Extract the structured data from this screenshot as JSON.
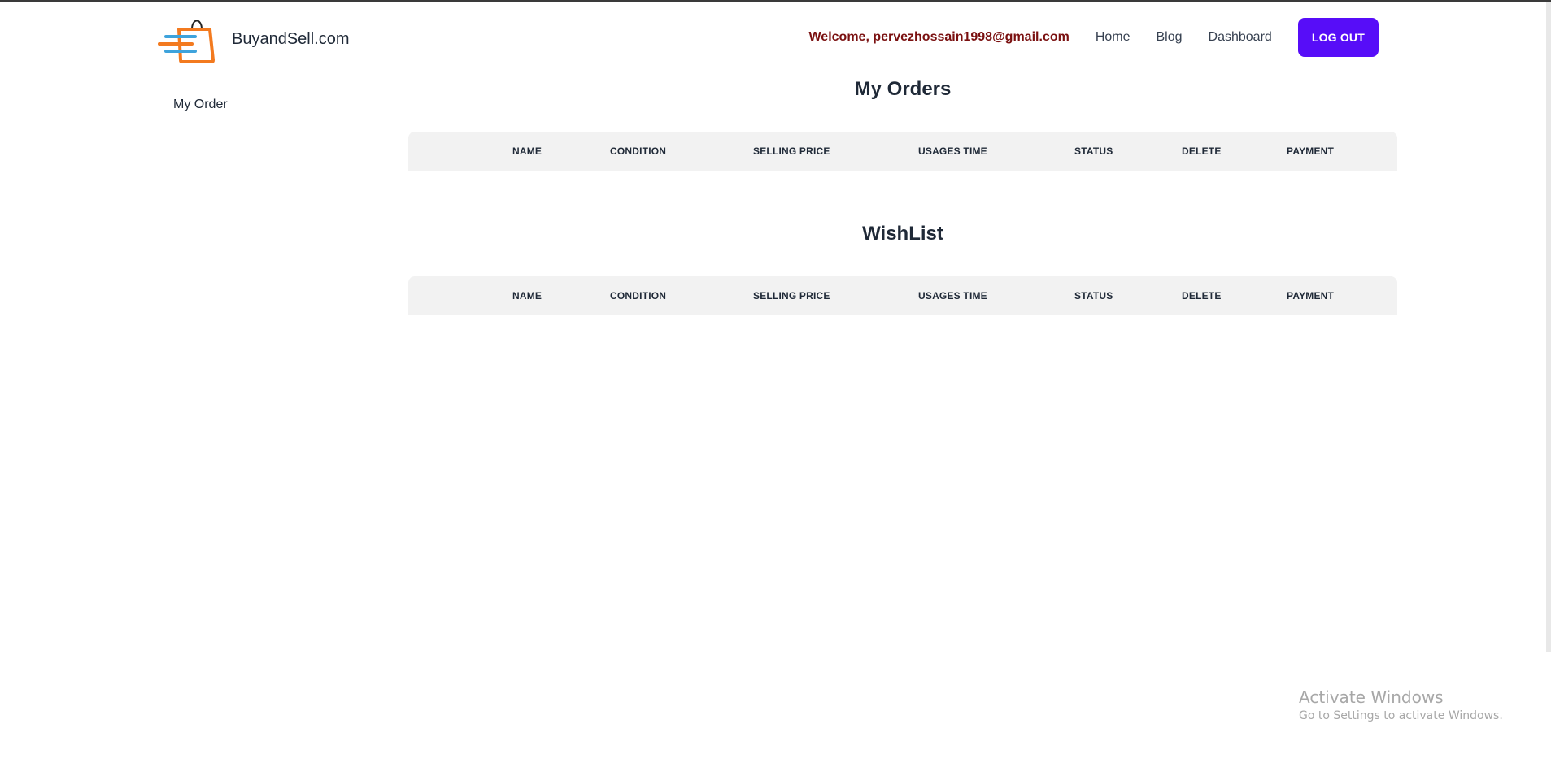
{
  "header": {
    "brand": "BuyandSell.com",
    "welcome": "Welcome, pervezhossain1998@gmail.com",
    "nav": {
      "home": "Home",
      "blog": "Blog",
      "dashboard": "Dashboard"
    },
    "logout_label": "LOG OUT"
  },
  "sidebar": {
    "items": [
      {
        "label": "My Order"
      }
    ]
  },
  "orders": {
    "title": "My Orders",
    "columns": [
      "",
      "Name",
      "Condition",
      "Selling Price",
      "Usages Time",
      "Status",
      "Delete",
      "Payment"
    ]
  },
  "wishlist": {
    "title": "WishList",
    "columns": [
      "",
      "Name",
      "Condition",
      "Selling Price",
      "Usages Time",
      "Status",
      "Delete",
      "Payment"
    ]
  },
  "watermark": {
    "title": "Activate Windows",
    "subtitle": "Go to Settings to activate Windows."
  },
  "colors": {
    "primary": "#570df8",
    "welcome": "#7a1010",
    "table_header_bg": "#f2f2f2",
    "logo_orange": "#f37a1f",
    "logo_blue": "#3ea3dc"
  }
}
